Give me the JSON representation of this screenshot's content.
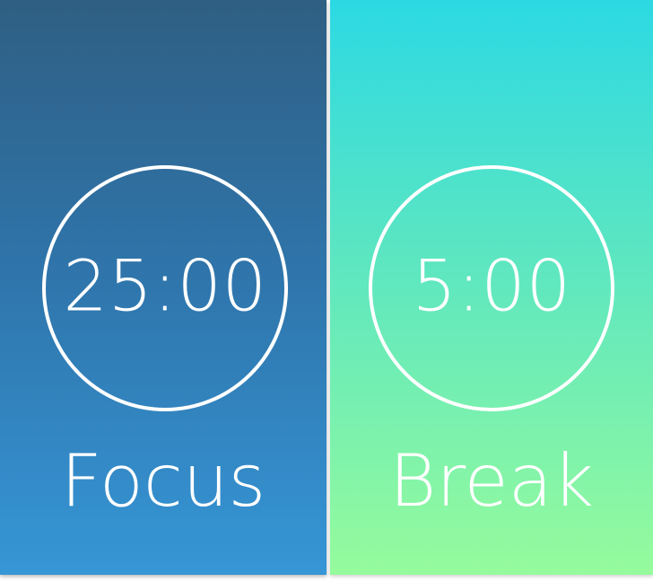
{
  "focus": {
    "time": "25:00",
    "label": "Focus",
    "colors": {
      "top": "#2f5f83",
      "bottom": "#3696d6"
    }
  },
  "break": {
    "time": "5:00",
    "label": "Break",
    "colors": {
      "top": "#2cd9e3",
      "bottom": "#96fb9c"
    }
  },
  "text_color": "#ffffff"
}
